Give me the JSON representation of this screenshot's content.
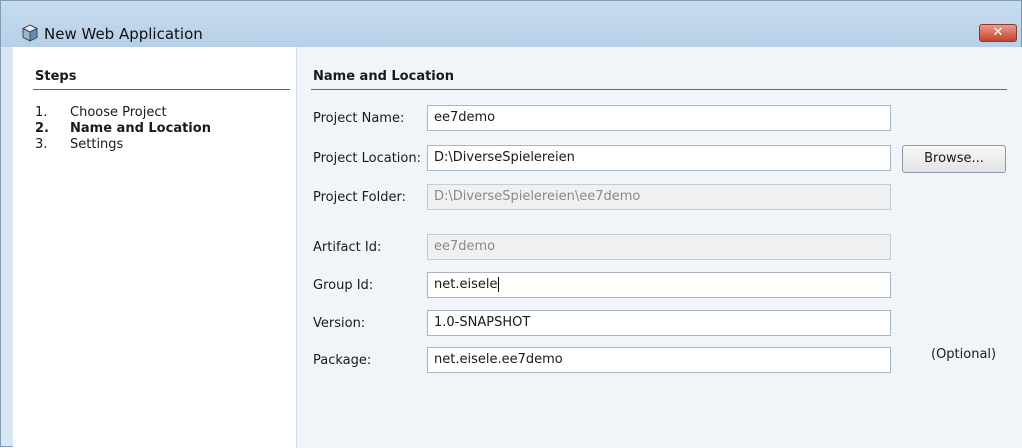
{
  "window": {
    "title": "New Web Application",
    "close_label": "✕"
  },
  "steps": {
    "title": "Steps",
    "items": [
      {
        "num": "1.",
        "label": "Choose Project"
      },
      {
        "num": "2.",
        "label": "Name and Location"
      },
      {
        "num": "3.",
        "label": "Settings"
      }
    ],
    "current_index": 1
  },
  "form": {
    "title": "Name and Location",
    "project_name_label": "Project Name:",
    "project_name_value": "ee7demo",
    "project_location_label": "Project Location:",
    "project_location_value": "D:\\DiverseSpielereien",
    "browse_label": "Browse...",
    "project_folder_label": "Project Folder:",
    "project_folder_value": "D:\\DiverseSpielereien\\ee7demo",
    "artifact_id_label": "Artifact Id:",
    "artifact_id_value": "ee7demo",
    "group_id_label": "Group Id:",
    "group_id_value": "net.eisele",
    "version_label": "Version:",
    "version_value": "1.0-SNAPSHOT",
    "package_label": "Package:",
    "package_value": "net.eisele.ee7demo",
    "optional_label": "(Optional)"
  },
  "icons": {
    "title_icon": "cube-icon",
    "close_icon": "close-icon"
  },
  "colors": {
    "title_bar": "#c8dcef",
    "close_button": "#c7442e",
    "content_background": "#f1f4f8"
  }
}
